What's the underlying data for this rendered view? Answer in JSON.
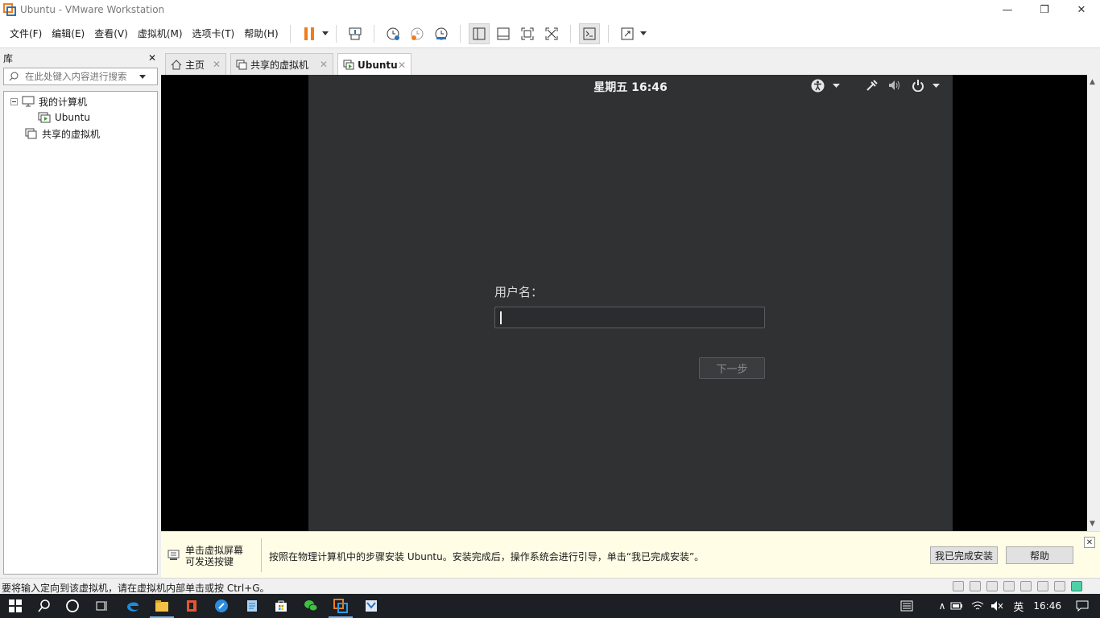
{
  "window": {
    "title": "Ubuntu - VMware Workstation",
    "controls": {
      "minimize": "—",
      "restore": "❐",
      "close": "✕"
    }
  },
  "menu": [
    "文件(F)",
    "编辑(E)",
    "查看(V)",
    "虚拟机(M)",
    "选项卡(T)",
    "帮助(H)"
  ],
  "toolbar": {
    "icons": [
      "pause-icon",
      "send-ctrl-alt-del-icon",
      "snapshot-icon",
      "revert-snapshot-icon",
      "snapshot-manager-icon",
      "library-view-icon",
      "thumbnail-bar-icon",
      "full-screen-icon",
      "unity-icon",
      "console-view-icon",
      "stretch-icon"
    ],
    "accent_pause": "#f07d1a"
  },
  "library": {
    "title": "库",
    "close": "✕",
    "search_placeholder": "在此处键入内容进行搜索",
    "tree": {
      "root_label": "我的计算机",
      "child_label": "Ubuntu",
      "shared_label": "共享的虚拟机"
    }
  },
  "tabs": [
    {
      "label": "主页",
      "icon": "home-icon",
      "close": "✕"
    },
    {
      "label": "共享的虚拟机",
      "icon": "shared-vm-icon",
      "close": "✕"
    },
    {
      "label": "Ubuntu",
      "icon": "vm-icon",
      "close": "✕"
    }
  ],
  "vm": {
    "clock": "星期五 16:46",
    "login_label": "用户名：",
    "next_button": "下一步",
    "indicators": [
      "accessibility-icon",
      "network-icon",
      "volume-icon",
      "power-icon"
    ],
    "bg_color": "#2f3133"
  },
  "notification": {
    "hint_line1": "单击虚拟屏幕",
    "hint_line2": "可发送按键",
    "message": "按照在物理计算机中的步骤安装 Ubuntu。安装完成后，操作系统会进行引导，单击“我已完成安装”。",
    "done_button": "我已完成安装",
    "help_button": "帮助",
    "close": "✕"
  },
  "status": {
    "text": "要将输入定向到该虚拟机，请在虚拟机内部单击或按 Ctrl+G。"
  },
  "taskbar": {
    "ime": "英",
    "time": "16:46",
    "apps": [
      "start-icon",
      "search-icon",
      "cortana-icon",
      "task-view-icon",
      "edge-icon",
      "explorer-icon",
      "office-icon",
      "app-blue-icon",
      "notes-icon",
      "store-icon",
      "wechat-icon",
      "vmware-icon",
      "app-mail-icon"
    ]
  }
}
